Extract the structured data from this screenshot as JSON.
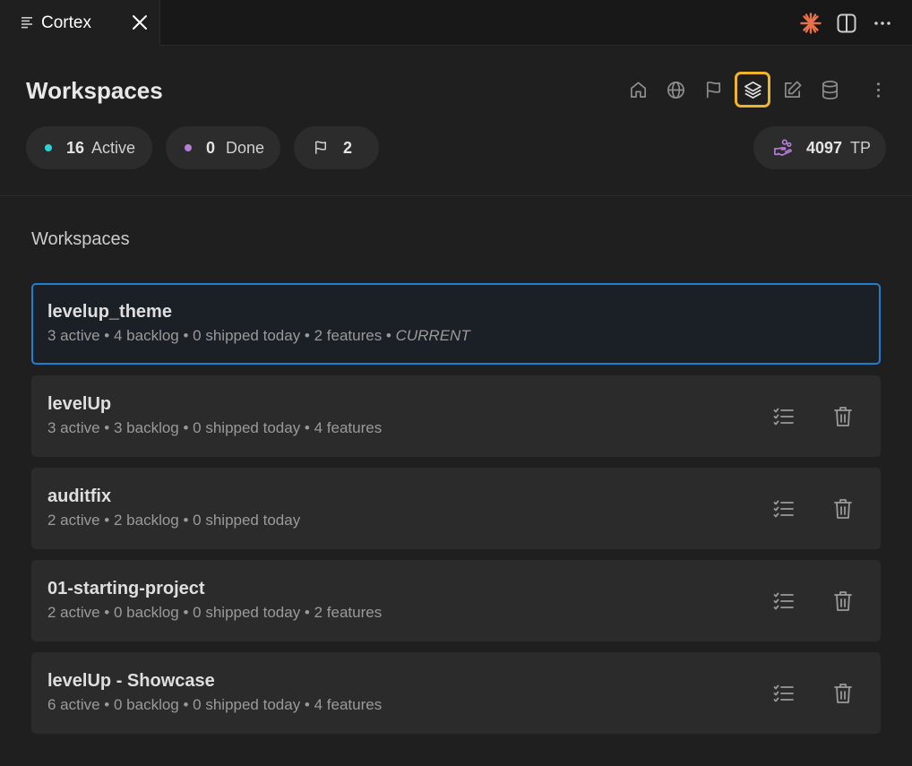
{
  "tab": {
    "title": "Cortex",
    "list_icon": "list-icon",
    "close_icon": "close-icon"
  },
  "window_actions": {
    "icons": [
      "claude-asterisk-icon",
      "split-panel-icon",
      "more-horizontal-icon"
    ],
    "accent_color": "#e8704a"
  },
  "header": {
    "title": "Workspaces",
    "toolbar_icons": [
      "home-icon",
      "globe-icon",
      "flag-icon",
      "layers-icon",
      "edit-icon",
      "database-icon",
      "more-vertical-icon"
    ],
    "active_tool": "layers-icon",
    "active_tool_color": "#f0b429"
  },
  "stats": {
    "active": {
      "count": "16",
      "label": "Active",
      "color": "#2ad4d4"
    },
    "done": {
      "count": "0",
      "label": "Done",
      "color": "#b57ed6"
    },
    "flags": {
      "count": "2",
      "icon": "flag-icon"
    },
    "tp": {
      "value": "4097",
      "unit": "TP",
      "icon": "hand-coins-icon",
      "color": "#b57ed6"
    }
  },
  "section": {
    "label": "Workspaces"
  },
  "workspaces": [
    {
      "name": "levelup_theme",
      "meta": "3 active • 4 backlog • 0 shipped today • 2 features • ",
      "tag": "CURRENT",
      "current": true
    },
    {
      "name": "levelUp",
      "meta": "3 active • 3 backlog • 0 shipped today • 4 features",
      "tag": "",
      "current": false
    },
    {
      "name": "auditfix",
      "meta": "2 active • 2 backlog • 0 shipped today",
      "tag": "",
      "current": false
    },
    {
      "name": "01-starting-project",
      "meta": "2 active • 0 backlog • 0 shipped today • 2 features",
      "tag": "",
      "current": false
    },
    {
      "name": "levelUp - Showcase",
      "meta": "6 active • 0 backlog • 0 shipped today • 4 features",
      "tag": "",
      "current": false
    }
  ],
  "card_actions": {
    "tasks_icon": "task-list-icon",
    "delete_icon": "trash-icon"
  },
  "colors": {
    "current_border": "#1f7fcf"
  }
}
